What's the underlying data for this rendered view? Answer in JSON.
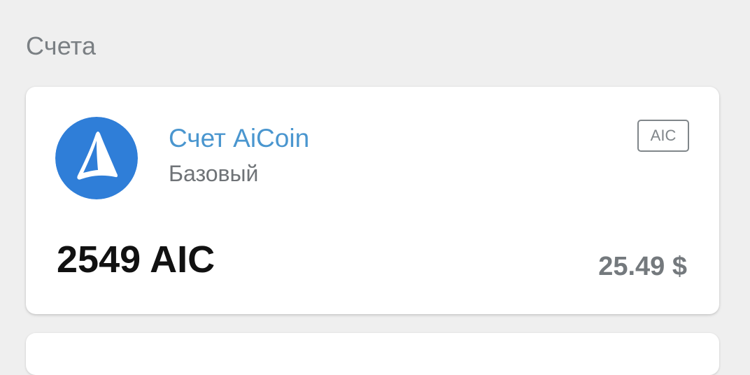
{
  "section": {
    "title": "Счета"
  },
  "account": {
    "name": "Счет AiCoin",
    "type": "Базовый",
    "currency_badge": "AIC",
    "balance": "2549 AIC",
    "fiat_value": "25.49 $",
    "icon": "aicoin-logo-icon",
    "colors": {
      "logo_background": "#2f7ed8",
      "name_text": "#4a96cf"
    }
  }
}
